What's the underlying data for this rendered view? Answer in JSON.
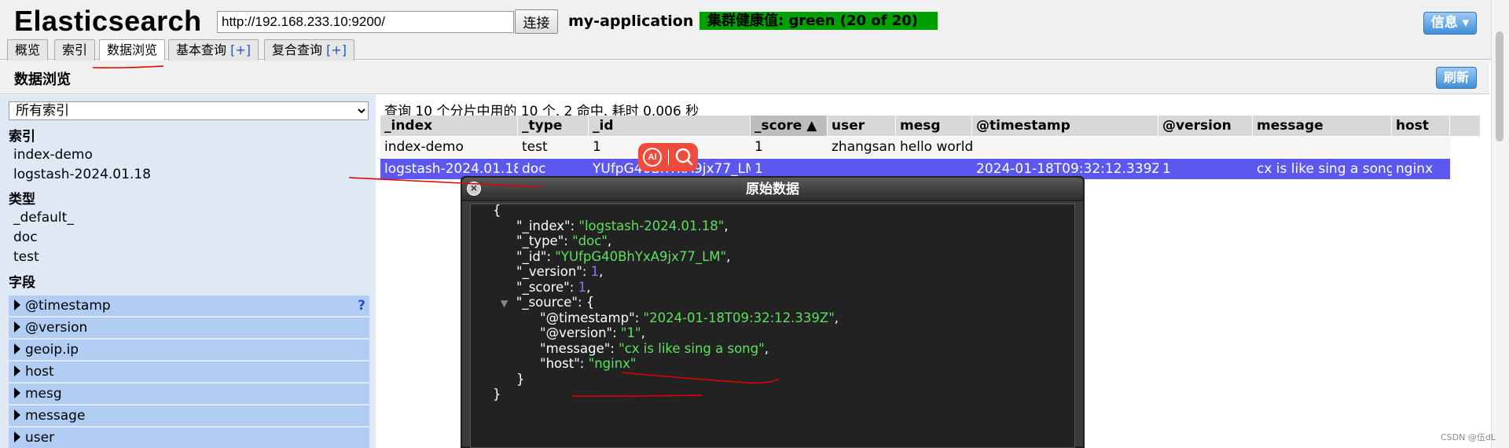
{
  "header": {
    "app_title": "Elasticsearch",
    "url_value": "http://192.168.233.10:9200/",
    "connect_label": "连接",
    "cluster_name": "my-application",
    "health_label": "集群健康值: green (20 of 20)",
    "info_label": "信息 ▾"
  },
  "tabs": [
    {
      "label": "概览",
      "plus": ""
    },
    {
      "label": "索引",
      "plus": ""
    },
    {
      "label": "数据浏览",
      "plus": ""
    },
    {
      "label": "基本查询 ",
      "plus": "[+]"
    },
    {
      "label": "复合查询 ",
      "plus": "[+]"
    }
  ],
  "section": {
    "title": "数据浏览",
    "refresh_label": "刷新"
  },
  "sidebar": {
    "index_select": "所有索引",
    "indices_heading": "索引",
    "indices": [
      "index-demo",
      "logstash-2024.01.18"
    ],
    "types_heading": "类型",
    "types": [
      "_default_",
      "doc",
      "test"
    ],
    "fields_heading": "字段",
    "field_help": "?",
    "fields": [
      "@timestamp",
      "@version",
      "geoip.ip",
      "host",
      "mesg",
      "message",
      "user"
    ]
  },
  "results": {
    "summary": "查询 10 个分片中用的 10 个. 2 命中. 耗时 0.006 秒",
    "columns": [
      "_index",
      "_type",
      "_id",
      "_score ▲",
      "user",
      "mesg",
      "@timestamp",
      "@version",
      "message",
      "host"
    ],
    "rows": [
      [
        "index-demo",
        "test",
        "1",
        "1",
        "zhangsan",
        "hello world",
        "",
        "",
        "",
        ""
      ],
      [
        "logstash-2024.01.18",
        "doc",
        "YUfpG40BhYxA9jx77_LM",
        "1",
        "",
        "",
        "2024-01-18T09:32:12.339Z",
        "1",
        "cx is like sing a song",
        "nginx"
      ]
    ]
  },
  "ai_widget": {
    "ai_label": "AI"
  },
  "raw_dialog": {
    "title": "原始数据",
    "close_glyph": "×",
    "lines": [
      {
        "indent": 0,
        "key": "",
        "value": "{",
        "vtype": "plain",
        "trail": ""
      },
      {
        "indent": 1,
        "key": "\"_index\": ",
        "value": "\"logstash-2024.01.18\"",
        "vtype": "str",
        "trail": ","
      },
      {
        "indent": 1,
        "key": "\"_type\": ",
        "value": "\"doc\"",
        "vtype": "str",
        "trail": ","
      },
      {
        "indent": 1,
        "key": "\"_id\": ",
        "value": "\"YUfpG40BhYxA9jx77_LM\"",
        "vtype": "str",
        "trail": ","
      },
      {
        "indent": 1,
        "key": "\"_version\": ",
        "value": "1",
        "vtype": "num",
        "trail": ","
      },
      {
        "indent": 1,
        "key": "\"_score\": ",
        "value": "1",
        "vtype": "num",
        "trail": ","
      },
      {
        "indent": 1,
        "key": "\"_source\": ",
        "value": "{",
        "vtype": "plain",
        "trail": "",
        "tri": "▼"
      },
      {
        "indent": 2,
        "key": "\"@timestamp\": ",
        "value": "\"2024-01-18T09:32:12.339Z\"",
        "vtype": "str",
        "trail": ","
      },
      {
        "indent": 2,
        "key": "\"@version\": ",
        "value": "\"1\"",
        "vtype": "str",
        "trail": ","
      },
      {
        "indent": 2,
        "key": "\"message\": ",
        "value": "\"cx is like sing a song\"",
        "vtype": "str",
        "trail": ","
      },
      {
        "indent": 2,
        "key": "\"host\": ",
        "value": "\"nginx\"",
        "vtype": "str",
        "trail": ""
      },
      {
        "indent": 1,
        "key": "",
        "value": "}",
        "vtype": "plain",
        "trail": ""
      },
      {
        "indent": 0,
        "key": "",
        "value": "}",
        "vtype": "plain",
        "trail": ""
      }
    ]
  },
  "colors": {
    "health_green": "#00a000",
    "selected_row": "#5c57ee",
    "sidebar_bg": "#dfe9f6",
    "field_row": "#b2cdf4",
    "json_string": "#5ee05e",
    "json_number": "#7c7cff",
    "annotation_red": "#e00000"
  },
  "watermark": "CSDN @伍dL"
}
